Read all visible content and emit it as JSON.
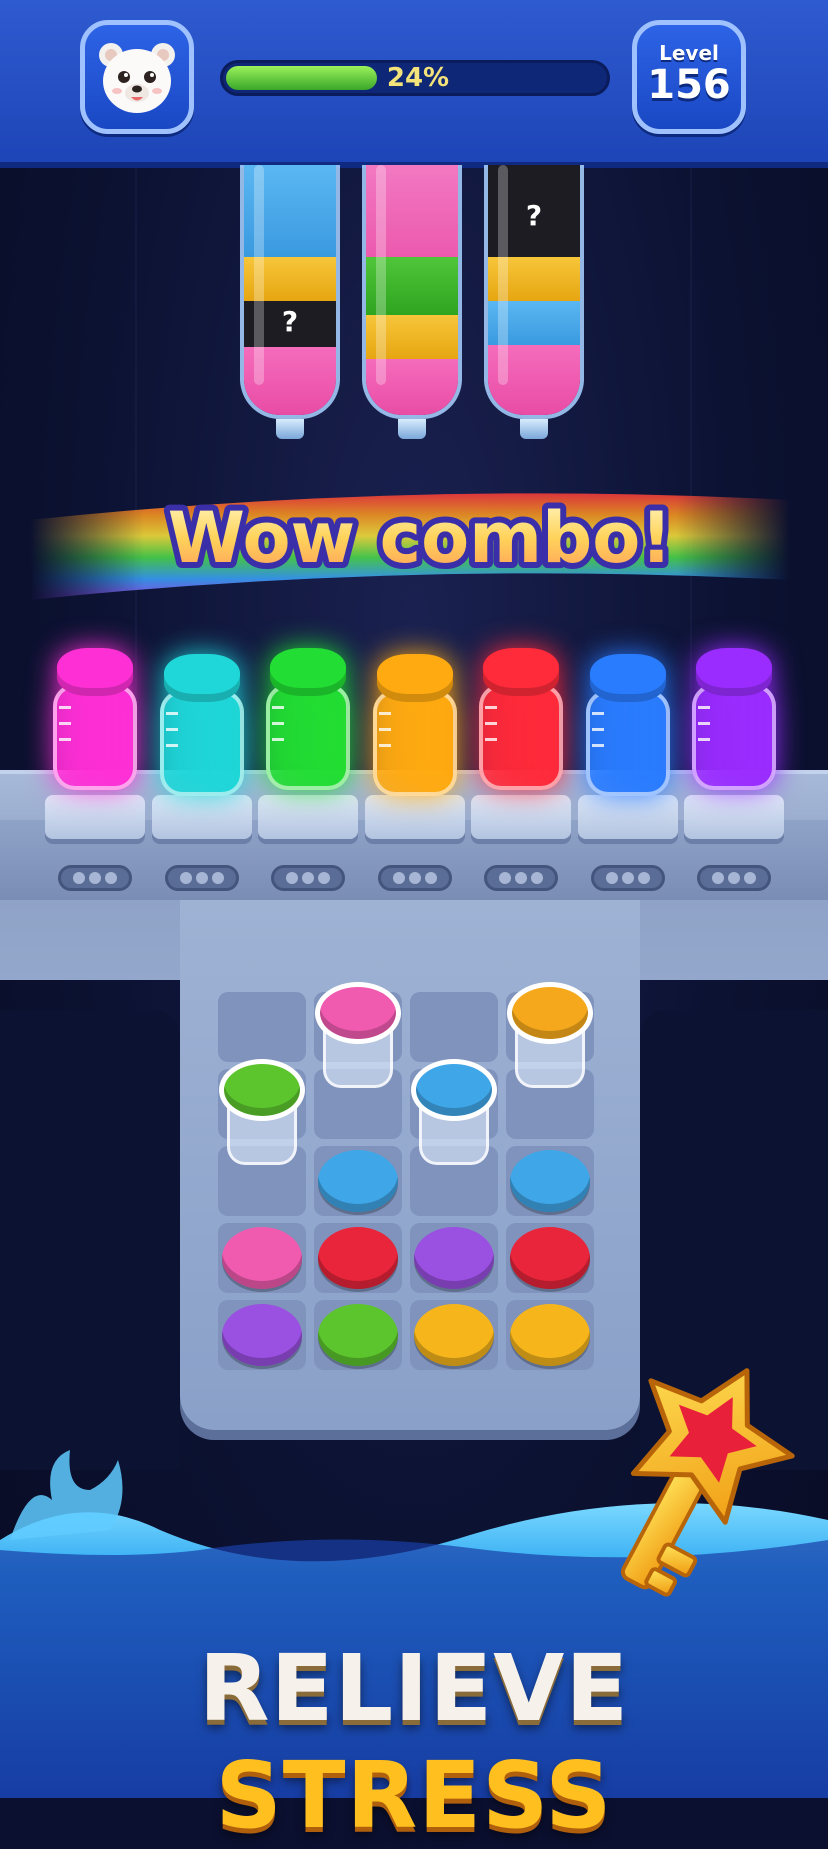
{
  "header": {
    "progress_label": "24%",
    "progress_fraction": 0.24,
    "level_label": "Level",
    "level_value": "156"
  },
  "tubes": [
    {
      "layers_top_to_bottom": [
        "blue",
        "yellow",
        "hidden",
        "pink"
      ],
      "hidden_symbol": "?"
    },
    {
      "layers_top_to_bottom": [
        "pink",
        "green",
        "yellow",
        "pink"
      ]
    },
    {
      "layers_top_to_bottom": [
        "hidden",
        "yellow",
        "blue",
        "pink"
      ],
      "hidden_symbol": "?"
    }
  ],
  "banner": {
    "text": "Wow combo!"
  },
  "completed_jars": [
    {
      "color": "#ff2fd6"
    },
    {
      "color": "#1fd6d8"
    },
    {
      "color": "#22dd33"
    },
    {
      "color": "#ffaa11"
    },
    {
      "color": "#ff2a3a"
    },
    {
      "color": "#2a7cff"
    },
    {
      "color": "#9a2cff"
    }
  ],
  "board": {
    "rows": [
      [
        "empty",
        "jar-pink",
        "empty",
        "jar-orange"
      ],
      [
        "jar-green",
        "empty",
        "jar-blue",
        "empty"
      ],
      [
        "empty",
        "disc-blue",
        "empty",
        "disc-blue"
      ],
      [
        "disc-pink",
        "disc-red",
        "disc-purple",
        "disc-red"
      ],
      [
        "disc-purple",
        "disc-green",
        "disc-yellow",
        "disc-yellow"
      ]
    ]
  },
  "footer": {
    "word1": "RELIEVE",
    "word2": "STRESS"
  },
  "colors": {
    "pink": "#f05bb0",
    "blue": "#3fa6e8",
    "green": "#5cc52d",
    "yellow": "#f5b51b",
    "red": "#e8253a",
    "purple": "#9a50e0",
    "orange": "#f5a81b",
    "hidden": "#1a1a1e"
  },
  "icons": {
    "avatar": "polar-bear-avatar-icon",
    "key": "star-key-icon"
  }
}
